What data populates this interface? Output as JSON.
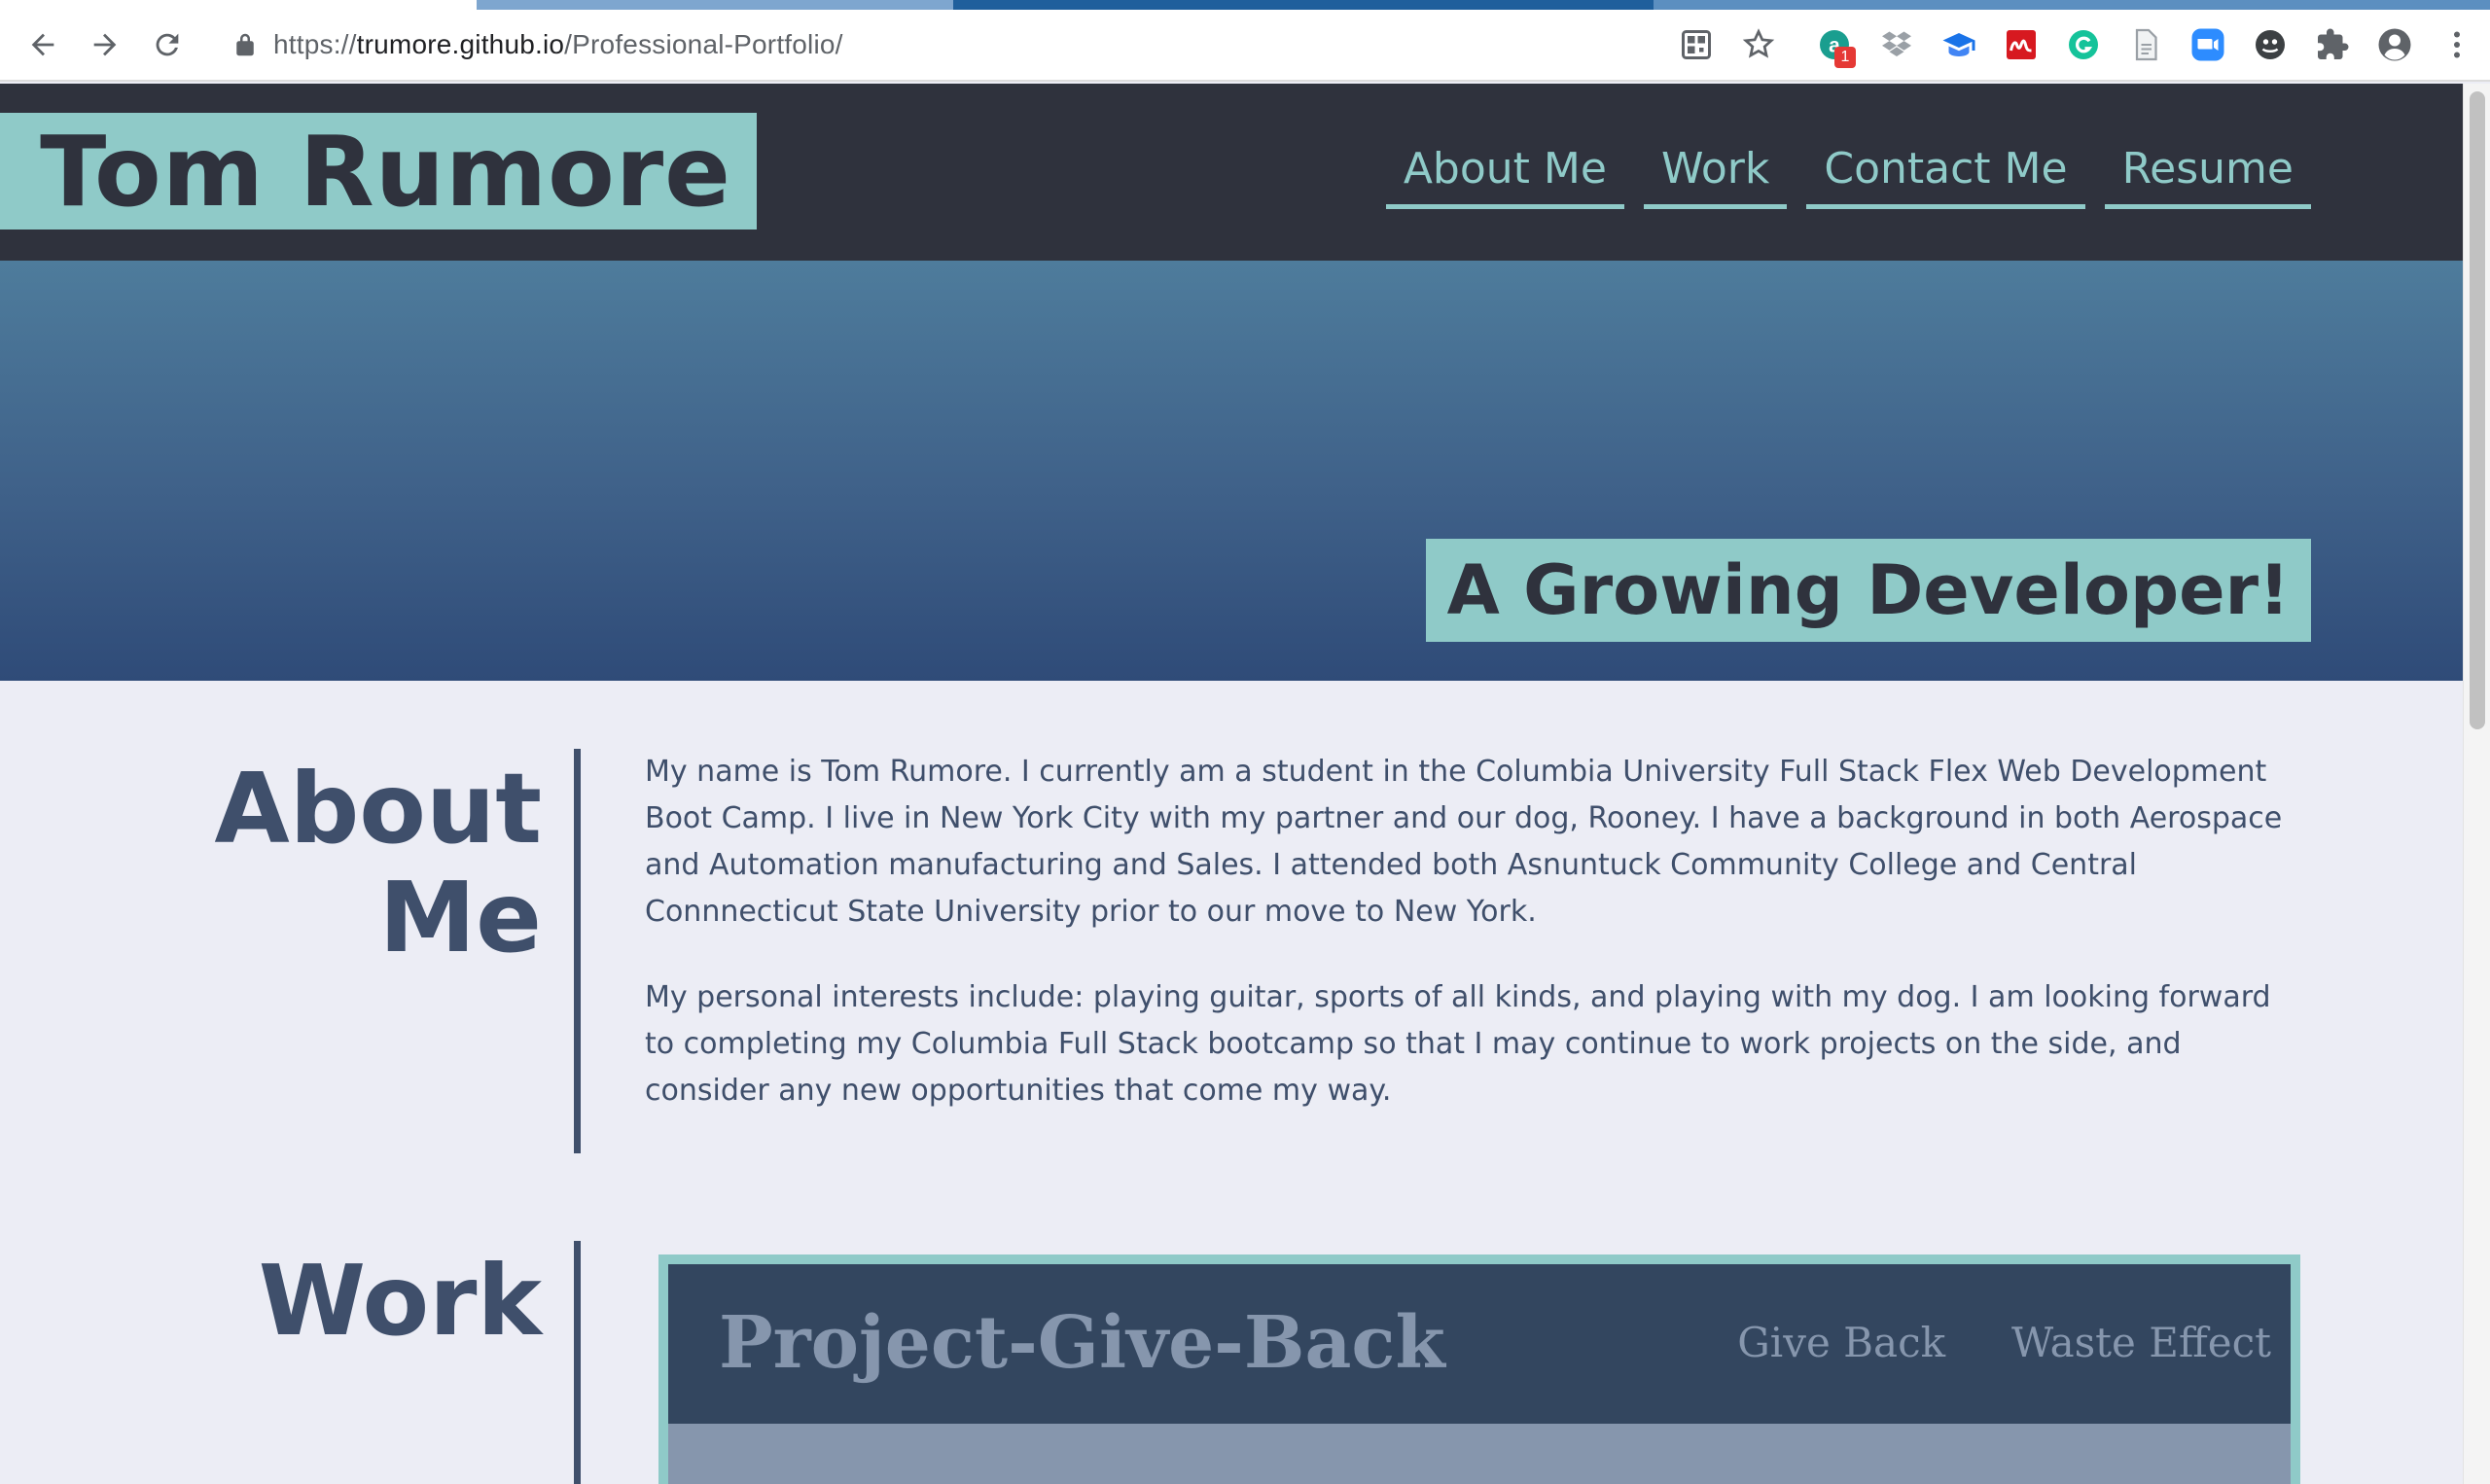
{
  "browser": {
    "url_scheme": "https://",
    "url_host": "trumore.github.io",
    "url_path": "/Professional-Portfolio/",
    "extensions": [
      {
        "name": "qr-code-icon"
      },
      {
        "name": "bookmark-star-icon"
      },
      {
        "name": "grammar-extension-icon",
        "badge": "1"
      },
      {
        "name": "dropbox-icon"
      },
      {
        "name": "graduation-cap-icon"
      },
      {
        "name": "mendeley-icon"
      },
      {
        "name": "grammarly-icon"
      },
      {
        "name": "document-icon"
      },
      {
        "name": "zoom-video-icon"
      },
      {
        "name": "ghostery-icon"
      },
      {
        "name": "puzzle-extensions-icon"
      },
      {
        "name": "profile-avatar-icon"
      },
      {
        "name": "kebab-menu-icon"
      }
    ]
  },
  "header": {
    "name": "Tom Rumore",
    "nav": [
      "About Me",
      "Work",
      "Contact Me",
      "Resume"
    ]
  },
  "hero": {
    "tagline": "A Growing Developer!"
  },
  "about": {
    "title_line1": "About",
    "title_line2": "Me",
    "paragraph1": "My name is Tom Rumore. I currently am a student in the Columbia University Full Stack Flex Web Development Boot Camp. I live in New York City with my partner and our dog, Rooney. I have a background in both Aerospace and Automation manufacturing and Sales. I attended both Asnuntuck Community College and Central Connnecticut State University prior to our move to New York.",
    "paragraph2": "My personal interests include: playing guitar, sports of all kinds, and playing with my dog. I am looking forward to completing my Columbia Full Stack bootcamp so that I may continue to work projects on the side, and consider any new opportunities that come my way."
  },
  "work": {
    "title": "Work",
    "project": {
      "title": "Project-Give-Back",
      "links": [
        "Give Back",
        "Waste Effect"
      ]
    }
  },
  "colors": {
    "accent_teal": "#8fcac8",
    "header_dark": "#2f323d",
    "text_slate": "#3f4f6b",
    "page_bg": "#ecedf5"
  }
}
